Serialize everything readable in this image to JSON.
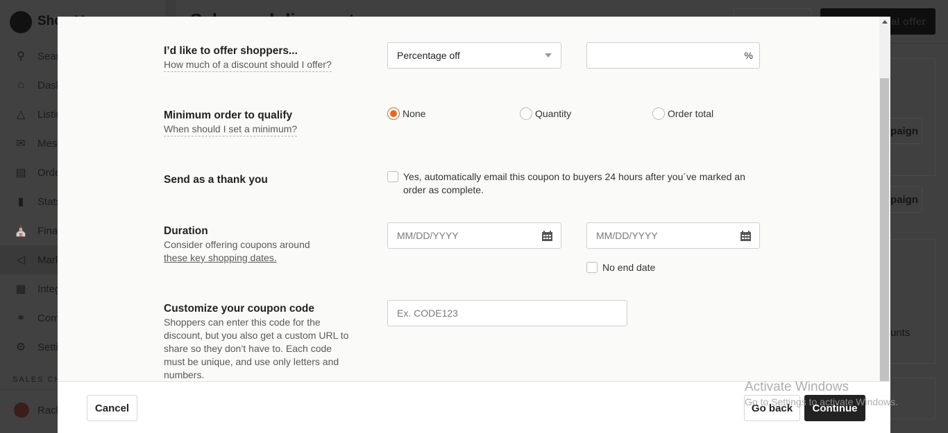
{
  "background": {
    "app_name": "Shop Manager",
    "page_title": "Sales and discounts",
    "header_primary_button": "Create a special offer",
    "sidebar": {
      "items": [
        {
          "label": "Search",
          "icon": "search-icon"
        },
        {
          "label": "Dashboard",
          "icon": "home-icon"
        },
        {
          "label": "Listings",
          "icon": "shapes-icon"
        },
        {
          "label": "Messages",
          "icon": "envelope-icon"
        },
        {
          "label": "Orders & Shipping",
          "icon": "clipboard-icon"
        },
        {
          "label": "Stats",
          "icon": "bar-chart-icon"
        },
        {
          "label": "Finances",
          "icon": "bank-icon"
        },
        {
          "label": "Marketing",
          "icon": "megaphone-icon"
        },
        {
          "label": "Integrations",
          "icon": "grid-icon"
        },
        {
          "label": "Community & Help",
          "icon": "people-icon"
        },
        {
          "label": "Settings",
          "icon": "gear-icon"
        }
      ],
      "section_label": "SALES CHANNELS",
      "user_name": "Rachel"
    },
    "visible_fragments": {
      "campaign_button_1": "paign",
      "campaign_button_2": "paign",
      "discounts_link": "unts"
    }
  },
  "modal": {
    "fields": {
      "offer": {
        "title": "I’d like to offer shoppers...",
        "help": "How much of a discount should I offer?",
        "type_select_value": "Percentage off",
        "amount_value": "",
        "amount_suffix": "%"
      },
      "minimum": {
        "title": "Minimum order to qualify",
        "help": "When should I set a minimum?",
        "options": [
          {
            "label": "None",
            "checked": true
          },
          {
            "label": "Quantity",
            "checked": false
          },
          {
            "label": "Order total",
            "checked": false
          }
        ]
      },
      "thank_you": {
        "title": "Send as a thank you",
        "checkbox_label": "Yes, automatically email this coupon to buyers 24 hours after you´ve marked an order as complete.",
        "checked": false
      },
      "duration": {
        "title": "Duration",
        "desc": "Consider offering coupons around",
        "link": "these key shopping dates.",
        "start_placeholder": "MM/DD/YYYY",
        "end_placeholder": "MM/DD/YYYY",
        "no_end_date_label": "No end date",
        "no_end_date_checked": false
      },
      "coupon_code": {
        "title": "Customize your coupon code",
        "desc": "Shoppers can enter this code for the discount, but you also get a custom URL to share so they don’t have to. Each code must be unique, and use only letters and numbers.",
        "placeholder": "Ex. CODE123"
      }
    },
    "footer": {
      "cancel_label": "Cancel",
      "go_back_label": "Go back",
      "continue_label": "Continue"
    }
  },
  "watermark": {
    "title": "Activate Windows",
    "subtitle": "Go to Settings to activate Windows."
  },
  "colors": {
    "accent": "#f1641e",
    "primary_button": "#222222",
    "overlay": "#404040"
  }
}
